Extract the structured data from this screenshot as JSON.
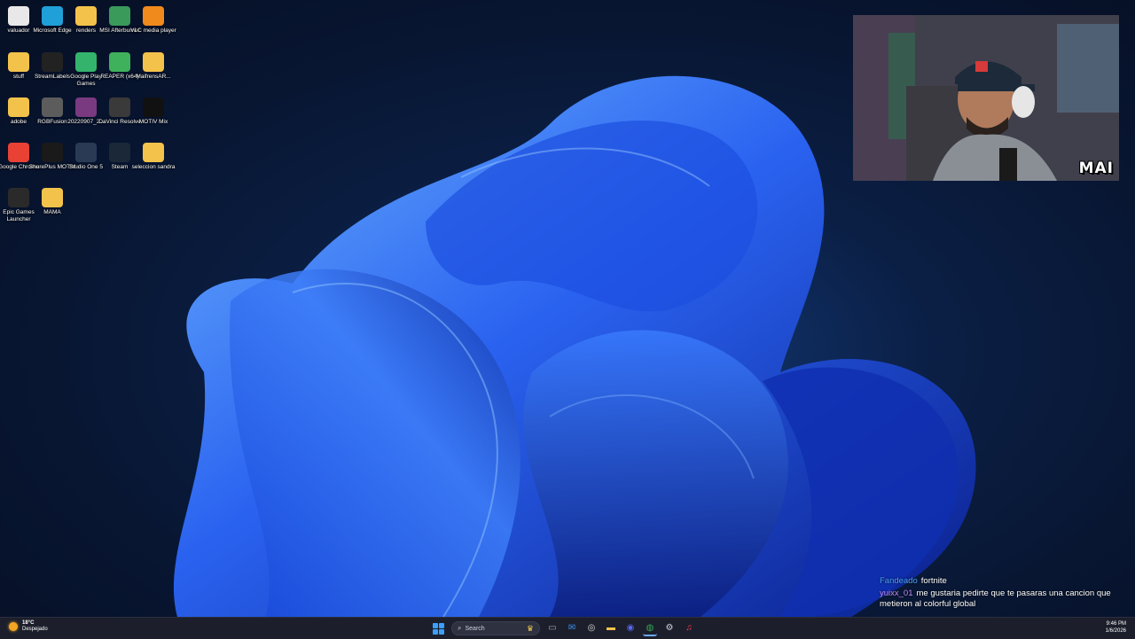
{
  "desktop": {
    "icons": [
      {
        "label": "valuador",
        "icon": "document-icon",
        "color": "#e8e8e8"
      },
      {
        "label": "Microsoft Edge",
        "icon": "edge-icon",
        "color": "#1fa0d8"
      },
      {
        "label": "renders",
        "icon": "folder-icon",
        "color": "#f3c24a"
      },
      {
        "label": "MSI Afterburner",
        "icon": "afterburner-icon",
        "color": "#3a9a5a"
      },
      {
        "label": "VLC media player",
        "icon": "vlc-icon",
        "color": "#f08a1c"
      },
      {
        "label": "stuff",
        "icon": "folder-icon",
        "color": "#f3c24a"
      },
      {
        "label": "StreamLabels",
        "icon": "streamlabels-icon",
        "color": "#222222"
      },
      {
        "label": "Google Play Games",
        "icon": "play-games-icon",
        "color": "#33b36b"
      },
      {
        "label": "REAPER (x64)",
        "icon": "reaper-icon",
        "color": "#3fb05c"
      },
      {
        "label": "MaifrensAR...",
        "icon": "folder-icon",
        "color": "#f3c24a"
      },
      {
        "label": "adobe",
        "icon": "folder-icon",
        "color": "#f3c24a"
      },
      {
        "label": "RGBFusion",
        "icon": "rgbfusion-icon",
        "color": "#5c5c5c"
      },
      {
        "label": "20220907_2...",
        "icon": "image-file-icon",
        "color": "#7a3a80"
      },
      {
        "label": "DaVinci Resolve",
        "icon": "davinci-icon",
        "color": "#3a3a3a"
      },
      {
        "label": "MOTIV Mix",
        "icon": "motiv-mix-icon",
        "color": "#111111"
      },
      {
        "label": "Google Chrome",
        "icon": "chrome-icon",
        "color": "#e94235"
      },
      {
        "label": "ShurePlus MOTIV",
        "icon": "shureplus-icon",
        "color": "#1a1a1a"
      },
      {
        "label": "Studio One 5",
        "icon": "studio-one-icon",
        "color": "#2a3a55"
      },
      {
        "label": "Steam",
        "icon": "steam-icon",
        "color": "#1b2838"
      },
      {
        "label": "seleccion sandra",
        "icon": "folder-icon",
        "color": "#f3c24a"
      },
      {
        "label": "Epic Games Launcher",
        "icon": "epic-games-icon",
        "color": "#2a2a2a"
      },
      {
        "label": "MAMA",
        "icon": "folder-icon",
        "color": "#f3c24a"
      }
    ]
  },
  "webcam": {
    "watermark": "MAI"
  },
  "chat": {
    "messages": [
      {
        "user": "Fandeado",
        "text": "fortnite"
      },
      {
        "user": "yuixx_01",
        "text": "me gustaria pedirte que te pasaras una cancion que metieron al colorful global"
      }
    ]
  },
  "taskbar": {
    "weather": {
      "temp": "18°C",
      "condition": "Despejado"
    },
    "search_placeholder": "Search",
    "pinned": [
      {
        "icon": "task-view-icon",
        "glyph": "▭",
        "color": "#9aa3b5"
      },
      {
        "icon": "mail-icon",
        "glyph": "✉",
        "color": "#3b8eea"
      },
      {
        "icon": "obs-icon",
        "glyph": "◎",
        "color": "#d9d9d9"
      },
      {
        "icon": "file-explorer-icon",
        "glyph": "▬",
        "color": "#f3c24a"
      },
      {
        "icon": "discord-icon",
        "glyph": "◉",
        "color": "#5865f2"
      },
      {
        "icon": "chrome-icon",
        "glyph": "◍",
        "color": "#34a853"
      },
      {
        "icon": "settings-icon",
        "glyph": "⚙",
        "color": "#cfd3dc"
      },
      {
        "icon": "music-icon",
        "glyph": "♫",
        "color": "#fa3c4c"
      }
    ],
    "time": "9:46 PM",
    "date": "1/6/2026"
  }
}
